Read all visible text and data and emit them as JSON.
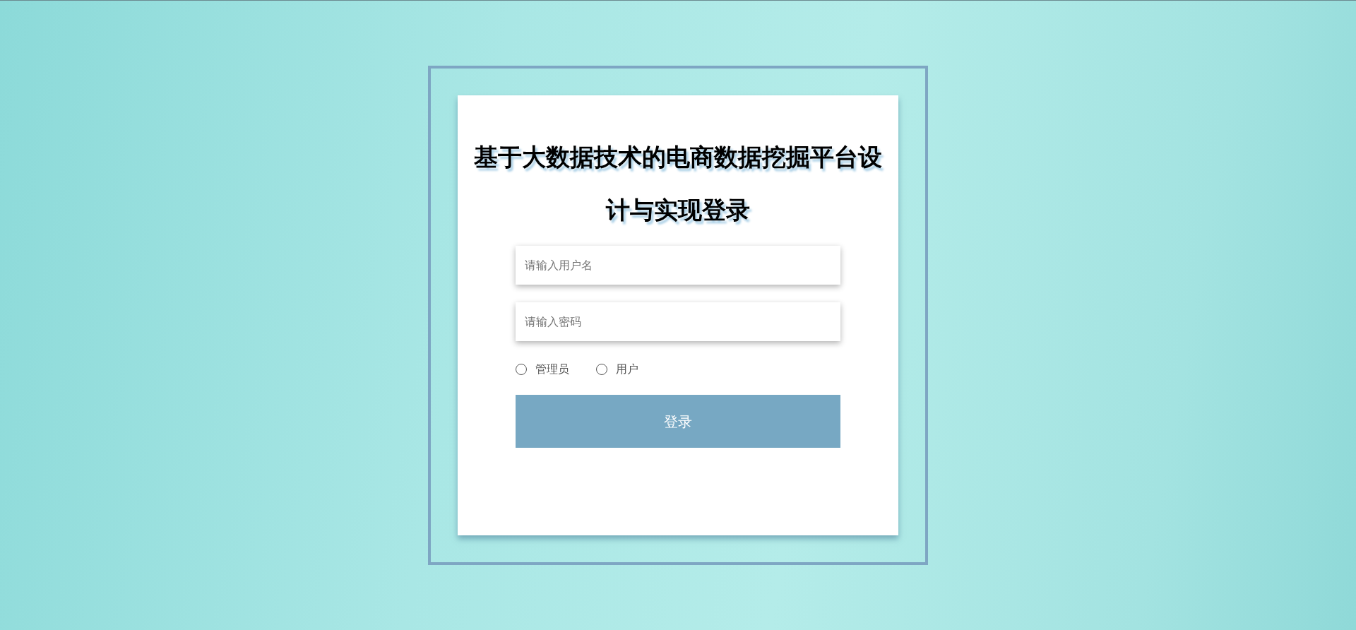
{
  "title": "基于大数据技术的电商数据挖掘平台设计与实现登录",
  "fields": [
    {
      "placeholder": "请输入用户名"
    },
    {
      "placeholder": "请输入密码"
    }
  ],
  "roles": [
    {
      "label": "管理员",
      "selected": false
    },
    {
      "label": "用户",
      "selected": false
    }
  ],
  "submit": {
    "label": "登录"
  }
}
